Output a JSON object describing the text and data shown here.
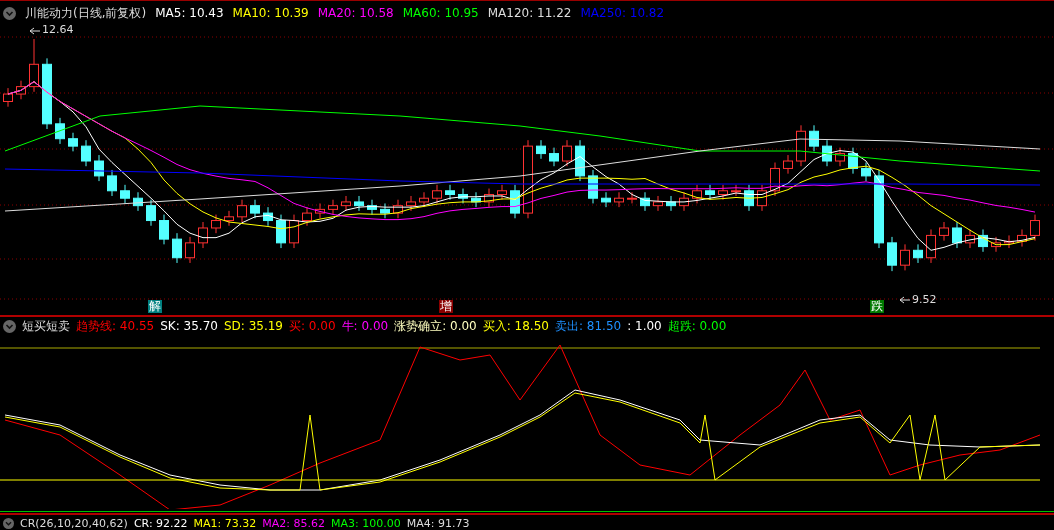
{
  "main": {
    "title": "川能动力(日线,前复权)",
    "ma": [
      {
        "label": "MA5: 10.43",
        "color": "#ffffff"
      },
      {
        "label": "MA10: 10.39",
        "color": "#ffff00"
      },
      {
        "label": "MA20: 10.58",
        "color": "#ff00ff"
      },
      {
        "label": "MA60: 10.95",
        "color": "#00ff00"
      },
      {
        "label": "MA120: 11.22",
        "color": "#dddddd"
      },
      {
        "label": "MA250: 10.82",
        "color": "#0000ff"
      }
    ],
    "high_label": "12.64",
    "low_label": "9.52",
    "signals": [
      {
        "text": "解",
        "color": "#008080"
      },
      {
        "text": "增",
        "color": "#8b0000"
      },
      {
        "text": "跌",
        "color": "#007a00"
      }
    ]
  },
  "indicator": {
    "title": "短买短卖",
    "values": [
      {
        "label": "趋势线: 40.55",
        "color": "#ff0000"
      },
      {
        "label": "SK: 35.70",
        "color": "#ffffff"
      },
      {
        "label": "SD: 35.19",
        "color": "#ffff00"
      },
      {
        "label": "买: 0.00",
        "color": "#ff0000"
      },
      {
        "label": "牛: 0.00",
        "color": "#ff00ff"
      },
      {
        "label": "涨势确立: 0.00",
        "color": "#ffffc0"
      },
      {
        "label": "买入: 18.50",
        "color": "#ffff00"
      },
      {
        "label": "卖出: 81.50",
        "color": "#1e90ff"
      },
      {
        "label": ": 1.00",
        "color": "#ffffff"
      },
      {
        "label": "超跌: 0.00",
        "color": "#00ff00"
      }
    ]
  },
  "bottom": {
    "title": "CR(26,10,20,40,62)",
    "values": [
      {
        "label": "CR: 92.22",
        "color": "#ffffff"
      },
      {
        "label": "MA1: 73.32",
        "color": "#ffff00"
      },
      {
        "label": "MA2: 85.62",
        "color": "#ff00ff"
      },
      {
        "label": "MA3: 100.00",
        "color": "#00ff00"
      },
      {
        "label": "MA4: 91.73",
        "color": "#dddddd"
      }
    ]
  }
}
